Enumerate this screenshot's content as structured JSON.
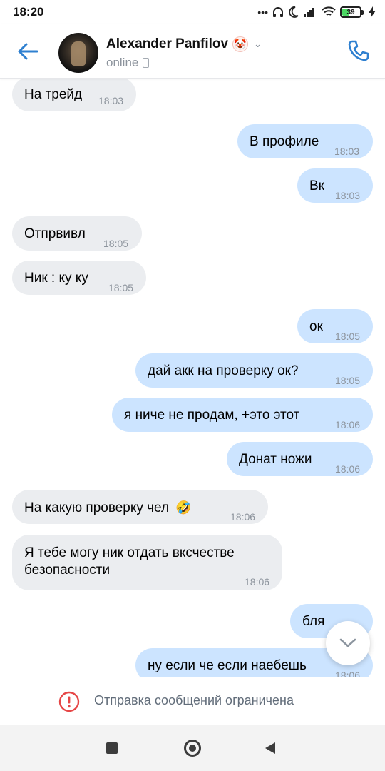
{
  "status_bar": {
    "time": "18:20",
    "icons": [
      "more-dots-icon",
      "headphones-icon",
      "moon-icon",
      "signal-icon",
      "wifi-icon",
      "battery-icon",
      "charging-icon"
    ],
    "battery_level": "39"
  },
  "header": {
    "contact_name": "Alexander Panfilov",
    "name_emoji": "🤡",
    "status": "online",
    "accent_color": "#2f80d0"
  },
  "messages": [
    {
      "direction": "in",
      "text": "На трейд",
      "time": "18:03"
    },
    {
      "direction": "out",
      "text": "В профиле",
      "time": "18:03"
    },
    {
      "direction": "out",
      "text": "Вк",
      "time": "18:03"
    },
    {
      "direction": "in",
      "text": "Отпрвивл",
      "time": "18:05"
    },
    {
      "direction": "in",
      "text": "Ник : ку ку",
      "time": "18:05"
    },
    {
      "direction": "out",
      "text": "ок",
      "time": "18:05"
    },
    {
      "direction": "out",
      "text": "дай акк на проверку ок?",
      "time": "18:05"
    },
    {
      "direction": "out",
      "text": "я ниче не продам, +это этот",
      "time": "18:06"
    },
    {
      "direction": "out",
      "text": "Донат ножи",
      "time": "18:06"
    },
    {
      "direction": "in",
      "text": "На какую проверку чел",
      "emoji": "🤣",
      "time": "18:06"
    },
    {
      "direction": "in",
      "text_lines": [
        "Я тебе могу ник отдать вксчестве",
        "безопасности"
      ],
      "time": "18:06"
    },
    {
      "direction": "out",
      "text": "бля",
      "time": ""
    },
    {
      "direction": "out",
      "text": "ну если че если наебешь",
      "time": "18:06"
    }
  ],
  "footer": {
    "restriction_text": "Отправка сообщений ограничена",
    "restriction_color": "#e64646"
  },
  "colors": {
    "incoming_bubble": "#ebedf0",
    "outgoing_bubble": "#cce4ff"
  }
}
